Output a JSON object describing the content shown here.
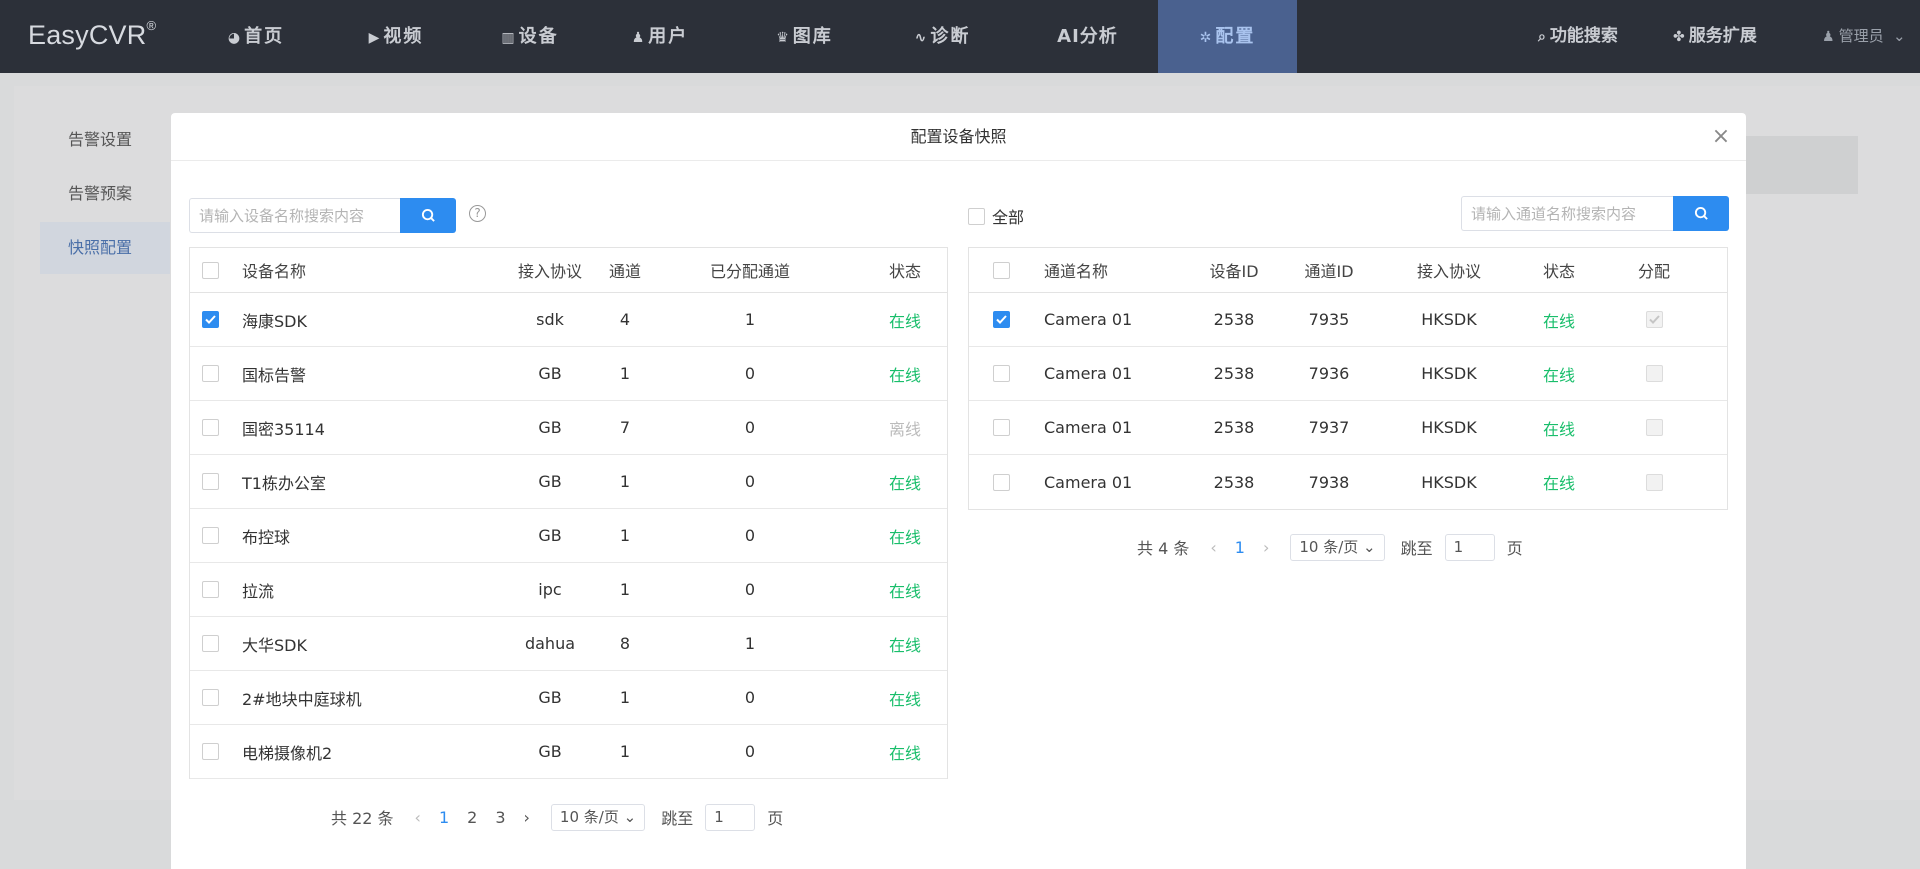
{
  "app": {
    "logo": "EasyCVR",
    "logo_mark": "®"
  },
  "nav": {
    "items": [
      {
        "label": "首页",
        "icon": "dashboard-icon"
      },
      {
        "label": "视频",
        "icon": "play-icon"
      },
      {
        "label": "设备",
        "icon": "device-icon"
      },
      {
        "label": "用户",
        "icon": "user-icon"
      },
      {
        "label": "图库",
        "icon": "gallery-icon"
      },
      {
        "label": "诊断",
        "icon": "pulse-icon"
      },
      {
        "label": "AI分析",
        "icon": ""
      },
      {
        "label": "配置",
        "icon": "gear-icon",
        "active": true
      }
    ],
    "search_label": "功能搜索",
    "extend_label": "服务扩展",
    "user_label": "管理员"
  },
  "sidebar": {
    "items": [
      {
        "label": "告警设置"
      },
      {
        "label": "告警预案"
      },
      {
        "label": "快照配置",
        "active": true
      }
    ]
  },
  "modal": {
    "title": "配置设备快照",
    "close": "×",
    "left": {
      "search_placeholder": "请输入设备名称搜索内容",
      "help": "?",
      "columns": [
        "设备名称",
        "接入协议",
        "通道",
        "已分配通道",
        "状态"
      ],
      "rows": [
        {
          "name": "海康SDK",
          "protocol": "sdk",
          "channels": "4",
          "assigned": "1",
          "status": "在线",
          "checked": true
        },
        {
          "name": "国标告警",
          "protocol": "GB",
          "channels": "1",
          "assigned": "0",
          "status": "在线",
          "checked": false
        },
        {
          "name": "国密35114",
          "protocol": "GB",
          "channels": "7",
          "assigned": "0",
          "status": "离线",
          "checked": false
        },
        {
          "name": "T1栋办公室",
          "protocol": "GB",
          "channels": "1",
          "assigned": "0",
          "status": "在线",
          "checked": false
        },
        {
          "name": "布控球",
          "protocol": "GB",
          "channels": "1",
          "assigned": "0",
          "status": "在线",
          "checked": false
        },
        {
          "name": "拉流",
          "protocol": "ipc",
          "channels": "1",
          "assigned": "0",
          "status": "在线",
          "checked": false
        },
        {
          "name": "大华SDK",
          "protocol": "dahua",
          "channels": "8",
          "assigned": "1",
          "status": "在线",
          "checked": false
        },
        {
          "name": "2#地块中庭球机",
          "protocol": "GB",
          "channels": "1",
          "assigned": "0",
          "status": "在线",
          "checked": false
        },
        {
          "name": "电梯摄像机2",
          "protocol": "GB",
          "channels": "1",
          "assigned": "0",
          "status": "在线",
          "checked": false
        }
      ],
      "pager": {
        "total": "共 22 条",
        "pages": [
          "1",
          "2",
          "3"
        ],
        "current": "1",
        "size": "10 条/页",
        "jump_label": "跳至",
        "jump_value": "1",
        "page_suffix": "页"
      }
    },
    "right": {
      "all_label": "全部",
      "search_placeholder": "请输入通道名称搜索内容",
      "columns": [
        "通道名称",
        "设备ID",
        "通道ID",
        "接入协议",
        "状态",
        "分配"
      ],
      "rows": [
        {
          "name": "Camera 01",
          "device_id": "2538",
          "channel_id": "7935",
          "protocol": "HKSDK",
          "status": "在线",
          "checked": true,
          "assigned": true
        },
        {
          "name": "Camera 01",
          "device_id": "2538",
          "channel_id": "7936",
          "protocol": "HKSDK",
          "status": "在线",
          "checked": false,
          "assigned": false
        },
        {
          "name": "Camera 01",
          "device_id": "2538",
          "channel_id": "7937",
          "protocol": "HKSDK",
          "status": "在线",
          "checked": false,
          "assigned": false
        },
        {
          "name": "Camera 01",
          "device_id": "2538",
          "channel_id": "7938",
          "protocol": "HKSDK",
          "status": "在线",
          "checked": false,
          "assigned": false
        }
      ],
      "pager": {
        "total": "共 4 条",
        "pages": [
          "1"
        ],
        "current": "1",
        "size": "10 条/页",
        "jump_label": "跳至",
        "jump_value": "1",
        "page_suffix": "页"
      }
    }
  },
  "colors": {
    "accent": "#2d8cf0",
    "online": "#19be6b",
    "offline": "#bbbbbb",
    "nav_bg": "#2c3039",
    "nav_active": "#4a618f"
  }
}
